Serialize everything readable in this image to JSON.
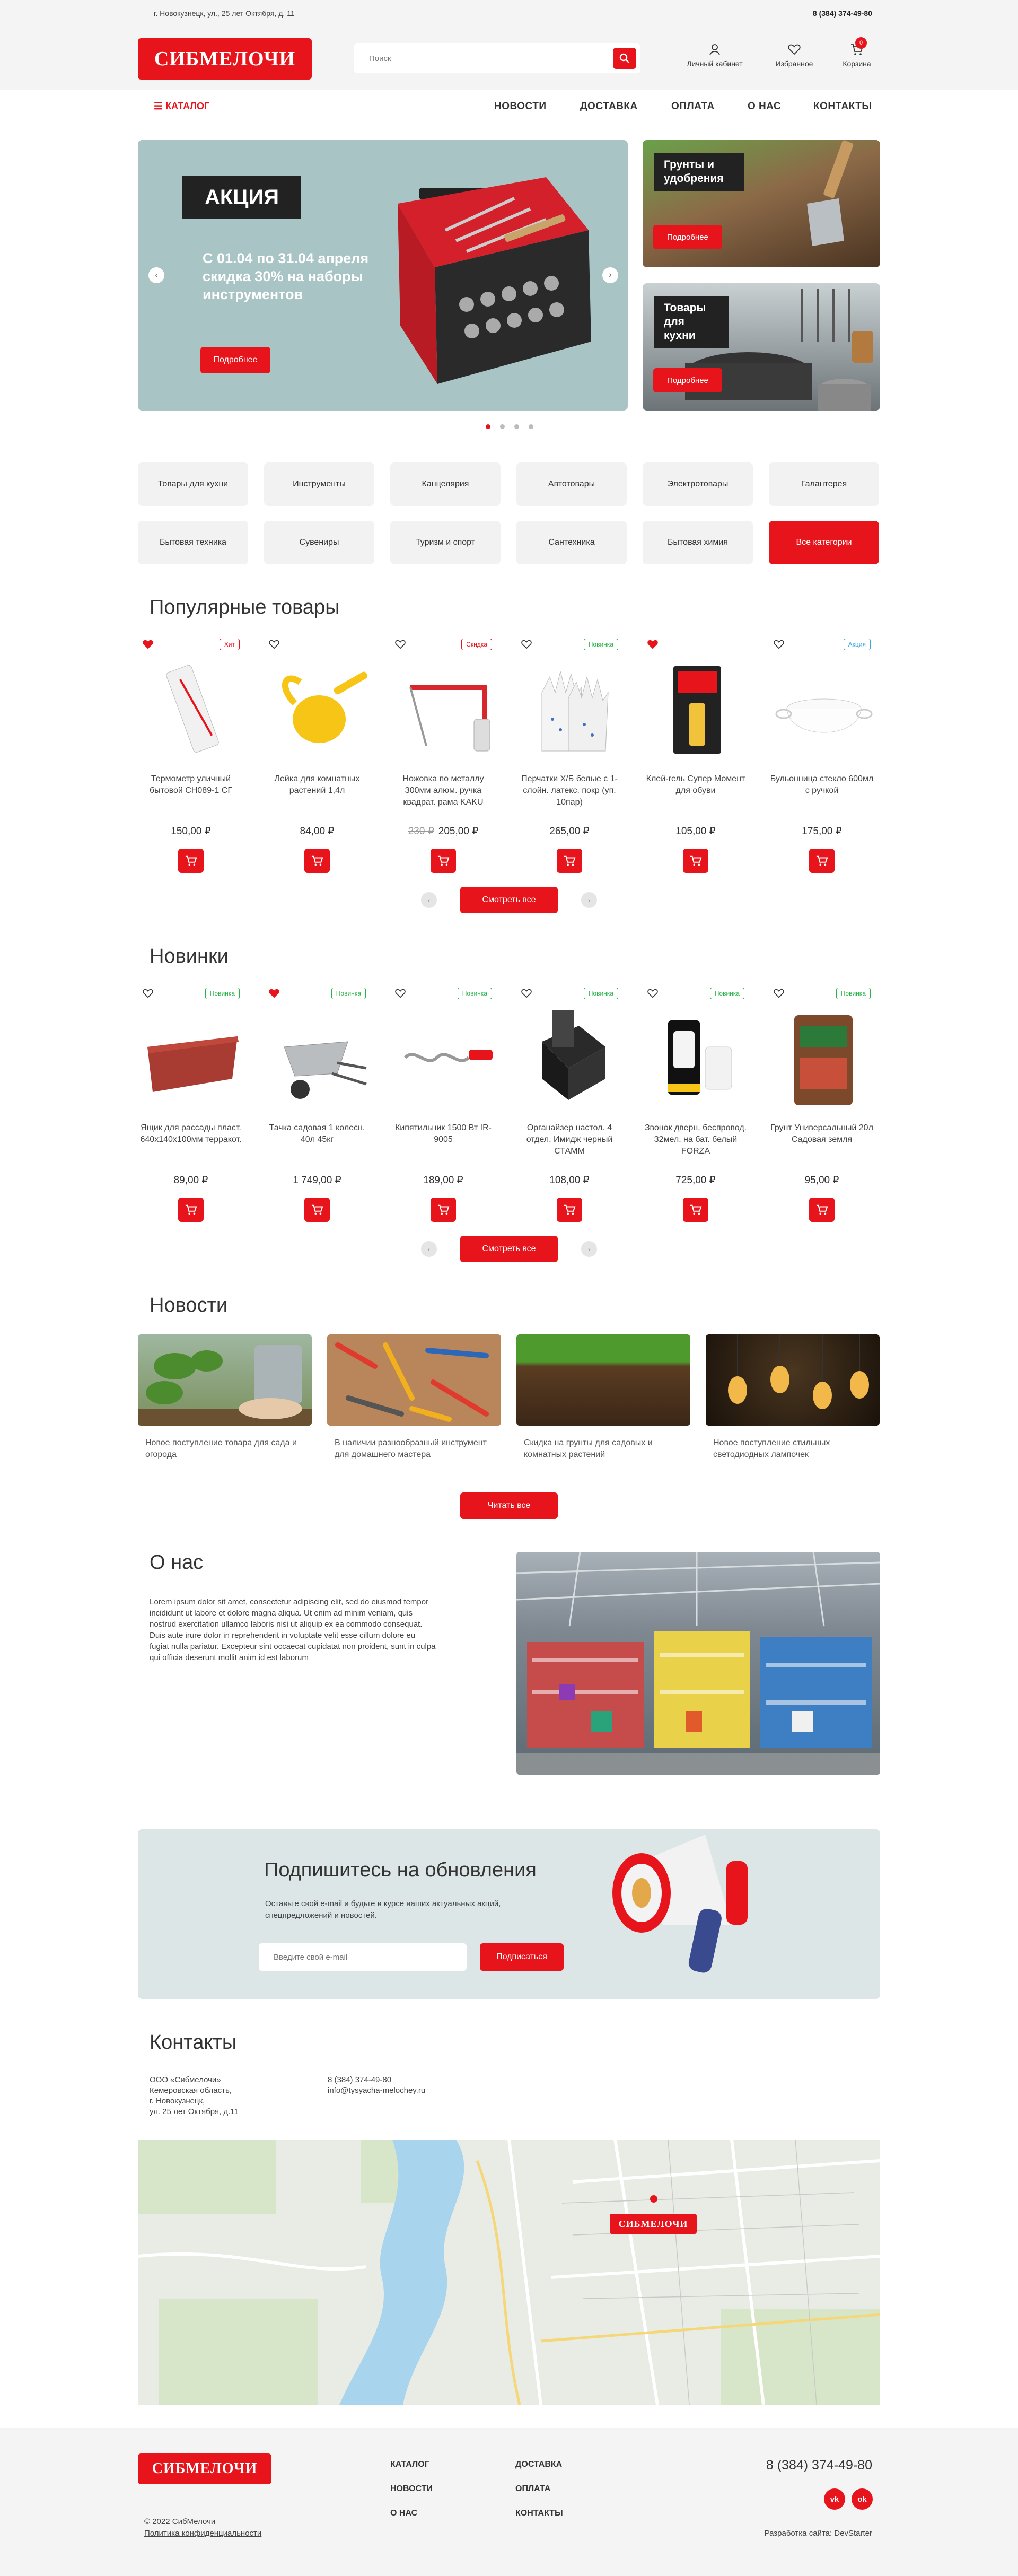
{
  "topbar": {
    "address": "г. Новокузнецк, ул., 25 лет Октября, д. 11",
    "phone": "8 (384) 374-49-80"
  },
  "brand": {
    "logo": "СИБМЕЛОЧИ",
    "accent": "#e8141c"
  },
  "search": {
    "placeholder": "Поиск"
  },
  "header_icons": {
    "account": "Личный кабинет",
    "favorites": "Избранное",
    "cart": "Корзина",
    "cart_count": "0"
  },
  "nav": {
    "catalog": "КАТАЛОГ",
    "links": [
      "НОВОСТИ",
      "ДОСТАВКА",
      "ОПЛАТА",
      "О НАС",
      "КОНТАКТЫ"
    ]
  },
  "hero": {
    "badge": "АКЦИЯ",
    "text": "С 01.04 по 31.04 апреля скидка 30% на наборы инструментов",
    "button": "Подробнее"
  },
  "promo": [
    {
      "title": "Грунты и удобрения",
      "button": "Подробнее"
    },
    {
      "title": "Товары для кухни",
      "button": "Подробнее"
    }
  ],
  "categories": [
    "Товары для кухни",
    "Инструменты",
    "Канцелярия",
    "Автотовары",
    "Электротовары",
    "Галантерея",
    "Бытовая техника",
    "Сувениры",
    "Туризм и спорт",
    "Сантехника",
    "Бытовая химия",
    "Все категории"
  ],
  "popular": {
    "title": "Популярные товары",
    "button": "Смотреть все",
    "items": [
      {
        "name": "Термометр уличный бытовой СН089-1 СГ",
        "price": "150,00 ₽",
        "old": "",
        "tag": "Хит",
        "tag_color": "#e8141c",
        "fav": true,
        "icon": "thermometer-image"
      },
      {
        "name": "Лейка для комнатных растений 1,4л",
        "price": "84,00 ₽",
        "old": "",
        "tag": "",
        "tag_color": "",
        "fav": false,
        "icon": "watering-can-image"
      },
      {
        "name": "Ножовка по металлу 300мм алюм. ручка квадрат. рама KAKU",
        "price": "205,00 ₽",
        "old": "230 ₽",
        "tag": "Скидка",
        "tag_color": "#e8141c",
        "fav": false,
        "icon": "hacksaw-image"
      },
      {
        "name": "Перчатки Х/Б белые с 1-слойн. латекс. покр (уп. 10пар)",
        "price": "265,00 ₽",
        "old": "",
        "tag": "Новинка",
        "tag_color": "#2bb34b",
        "fav": false,
        "icon": "gloves-image"
      },
      {
        "name": "Клей-гель Супер Момент для обуви",
        "price": "105,00 ₽",
        "old": "",
        "tag": "",
        "tag_color": "",
        "fav": true,
        "icon": "glue-image"
      },
      {
        "name": "Бульонница стекло 600мл с ручкой",
        "price": "175,00 ₽",
        "old": "",
        "tag": "Акция",
        "tag_color": "#3fa7e0",
        "fav": false,
        "icon": "bowl-image"
      }
    ]
  },
  "new": {
    "title": "Новинки",
    "button": "Смотреть все",
    "items": [
      {
        "name": "Ящик для рассады пласт. 640x140x100мм терракот.",
        "price": "89,00 ₽",
        "old": "",
        "tag": "Новинка",
        "tag_color": "#2bb34b",
        "fav": false,
        "icon": "planter-box-image"
      },
      {
        "name": "Тачка садовая 1 колесн. 40л 45кг",
        "price": "1 749,00 ₽",
        "old": "",
        "tag": "Новинка",
        "tag_color": "#2bb34b",
        "fav": true,
        "icon": "wheelbarrow-image"
      },
      {
        "name": "Кипятильник 1500 Вт IR-9005",
        "price": "189,00 ₽",
        "old": "",
        "tag": "Новинка",
        "tag_color": "#2bb34b",
        "fav": false,
        "icon": "immersion-heater-image"
      },
      {
        "name": "Органайзер настол. 4 отдел. Имидж черный СТАММ",
        "price": "108,00 ₽",
        "old": "",
        "tag": "Новинка",
        "tag_color": "#2bb34b",
        "fav": false,
        "icon": "desk-organizer-image"
      },
      {
        "name": "Звонок дверн. беспровод. 32мел. на бат. белый FORZA",
        "price": "725,00 ₽",
        "old": "",
        "tag": "Новинка",
        "tag_color": "#2bb34b",
        "fav": false,
        "icon": "doorbell-image"
      },
      {
        "name": "Грунт Универсальный 20л Садовая земля",
        "price": "95,00 ₽",
        "old": "",
        "tag": "Новинка",
        "tag_color": "#2bb34b",
        "fav": false,
        "icon": "soil-bag-image"
      }
    ]
  },
  "news": {
    "title": "Новости",
    "button": "Читать все",
    "items": [
      {
        "text": "Новое поступление товара для сада и огорода"
      },
      {
        "text": "В наличии разнообразный инструмент для домашнего мастера"
      },
      {
        "text": "Скидка на грунты для садовых и комнатных растений"
      },
      {
        "text": "Новое поступление стильных светодиодных лампочек"
      }
    ]
  },
  "about": {
    "title": "О нас",
    "text": "Lorem ipsum dolor sit amet, consectetur adipiscing elit, sed do eiusmod tempor incididunt ut labore et dolore magna aliqua. Ut enim ad minim veniam, quis nostrud exercitation ullamco laboris nisi ut aliquip ex ea commodo consequat. Duis aute irure dolor in reprehenderit in voluptate velit esse cillum dolore eu fugiat nulla pariatur. Excepteur sint occaecat cupidatat non proident, sunt in culpa qui officia deserunt mollit anim id est laborum"
  },
  "subscribe": {
    "title": "Подпишитесь на обновления",
    "text": "Оставьте свой e-mail и будьте в курсе наших актуальных акций, спецпредложений и новостей.",
    "placeholder": "Введите свой e-mail",
    "button": "Подписаться"
  },
  "contacts": {
    "title": "Контакты",
    "company": "ООО «Сибмелочи»",
    "region": "Кемеровская область,",
    "city": "г. Новокузнецк,",
    "street": "ул.  25 лет Октября, д.11",
    "phone": "8 (384) 374-49-80",
    "email": "info@tysyacha-melochey.ru",
    "map_pin": "СИБМЕЛОЧИ"
  },
  "footer": {
    "col1": [
      "КАТАЛОГ",
      "НОВОСТИ",
      "О НАС"
    ],
    "col2": [
      "ДОСТАВКА",
      "ОПЛАТА",
      "КОНТАКТЫ"
    ],
    "phone": "8 (384) 374-49-80",
    "copyright": "© 2022 СибМелочи",
    "privacy": "Политика конфиденциальности",
    "dev": "Разработка сайта: DevStarter",
    "vk": "vk",
    "ok": "ok"
  }
}
